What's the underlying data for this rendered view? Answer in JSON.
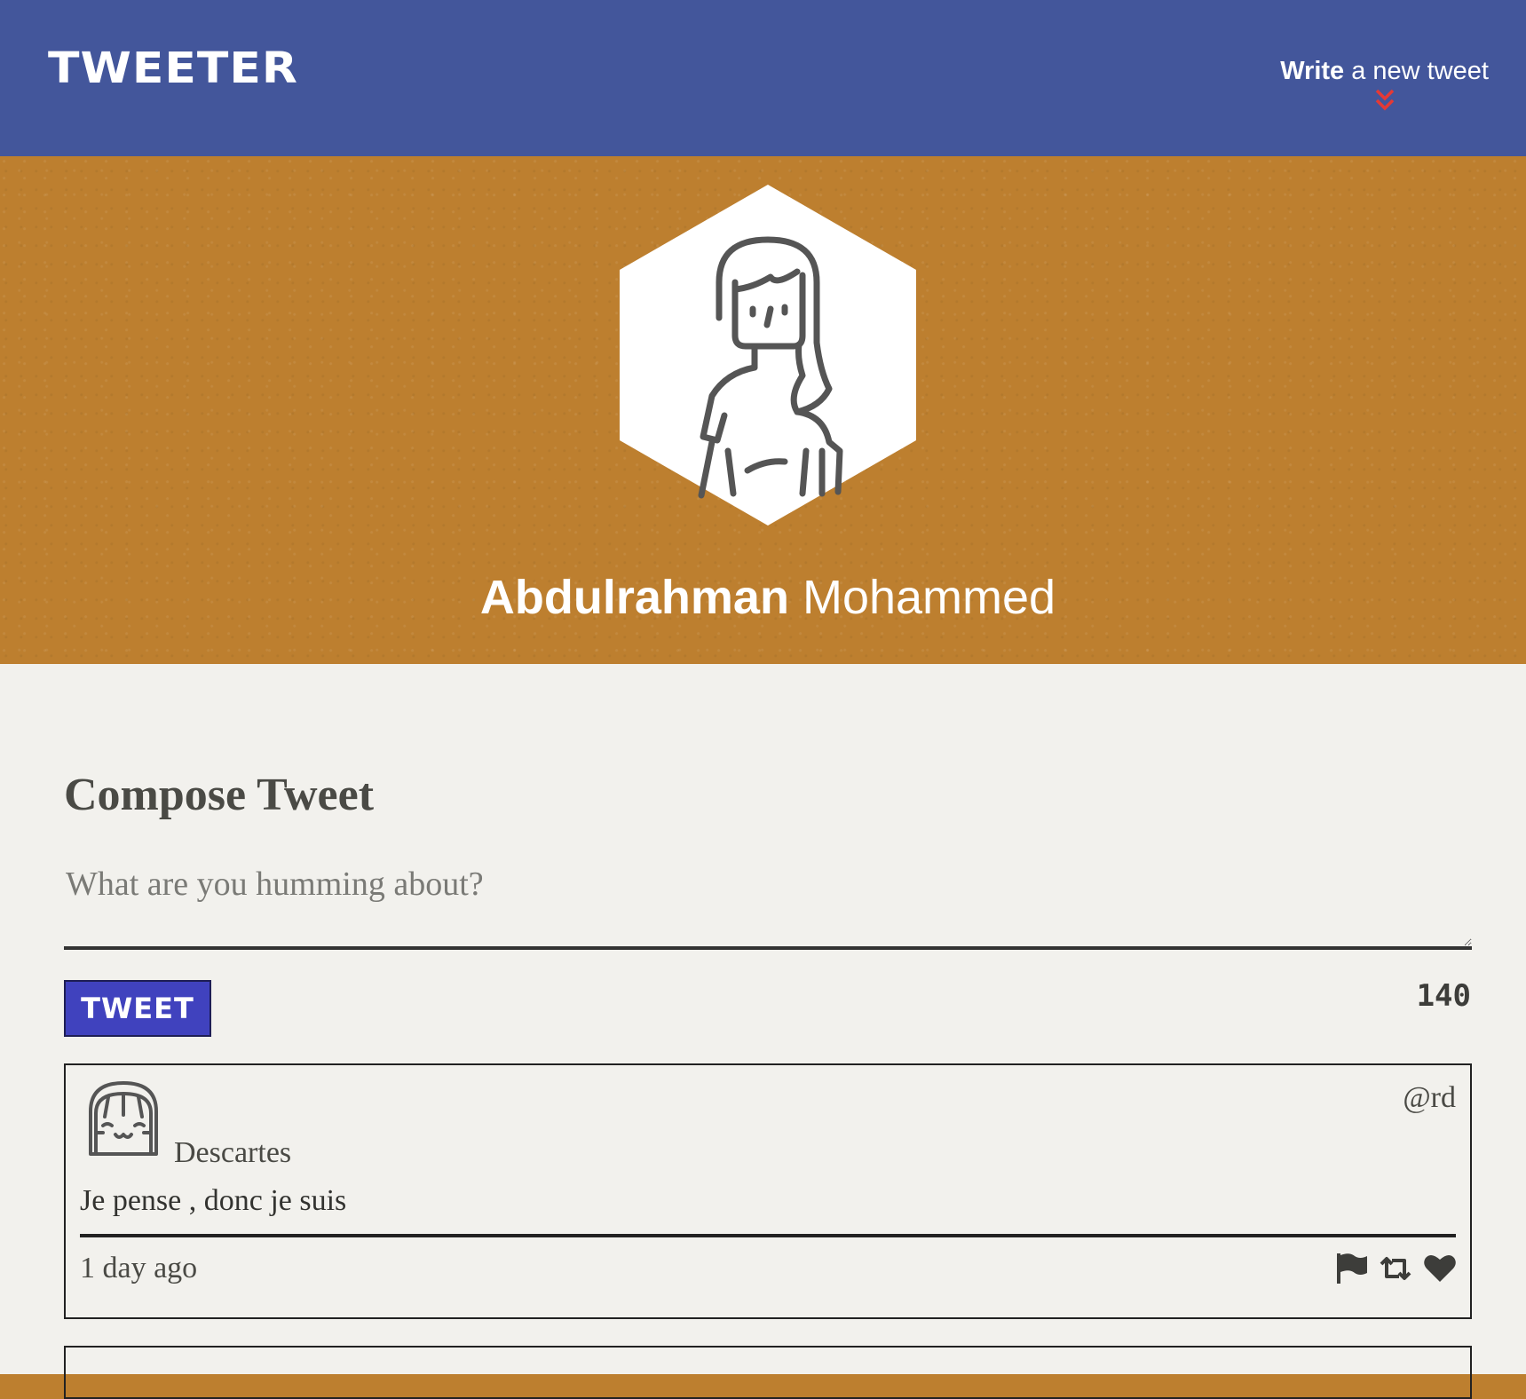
{
  "nav": {
    "brand": "TWEETER",
    "compose_bold": "Write",
    "compose_rest": " a new tweet",
    "chevron_icon": "double-chevron-down-icon",
    "accent": "#e53935"
  },
  "profile": {
    "first_name": "Abdulrahman",
    "last_name": " Mohammed",
    "avatar_icon": "person-avatar-icon",
    "banner_color": "#bd7f2f"
  },
  "compose": {
    "title": "Compose Tweet",
    "placeholder": "What are you humming about?",
    "button_label": "TWEET",
    "counter": "140",
    "button_color": "#4042be"
  },
  "tweets": [
    {
      "name": "Descartes",
      "handle": "@rd",
      "content": "Je pense , donc je suis",
      "time": "1 day ago",
      "actions": [
        "flag-icon",
        "retweet-icon",
        "heart-icon"
      ]
    }
  ]
}
